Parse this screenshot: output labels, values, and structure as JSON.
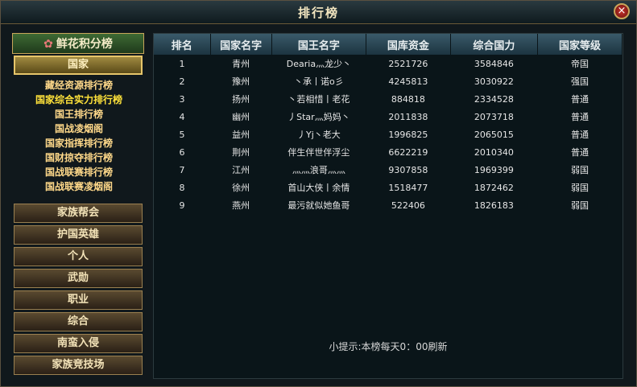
{
  "window": {
    "title": "排行榜",
    "close_label": "×"
  },
  "sidebar": {
    "header": "鲜花积分榜",
    "active_category": "国家",
    "sub_items": [
      {
        "label": "藏经资源排行榜"
      },
      {
        "label": "国家综合实力排行榜"
      },
      {
        "label": "国王排行榜"
      },
      {
        "label": "国战凌烟阁"
      },
      {
        "label": "国家指挥排行榜"
      },
      {
        "label": "国财掠夺排行榜"
      },
      {
        "label": "国战联赛排行榜"
      },
      {
        "label": "国战联赛凌烟阁"
      }
    ],
    "categories": [
      {
        "label": "家族帮会"
      },
      {
        "label": "护国英雄"
      },
      {
        "label": "个人"
      },
      {
        "label": "武勋"
      },
      {
        "label": "职业"
      },
      {
        "label": "综合"
      },
      {
        "label": "南蛮入侵"
      },
      {
        "label": "家族竞技场"
      }
    ]
  },
  "table": {
    "headers": [
      "排名",
      "国家名字",
      "国王名字",
      "国库资金",
      "综合国力",
      "国家等级"
    ],
    "rows": [
      [
        "1",
        "青州",
        "Dearia灬龙少丶",
        "2521726",
        "3584846",
        "帝国"
      ],
      [
        "2",
        "豫州",
        "丶承丨诺o彡",
        "4245813",
        "3030922",
        "强国"
      ],
      [
        "3",
        "扬州",
        "丶若相惜丨老花",
        "884818",
        "2334528",
        "普通"
      ],
      [
        "4",
        "幽州",
        "丿Star灬妈妈丶",
        "2011838",
        "2073718",
        "普通"
      ],
      [
        "5",
        "益州",
        "丿Yj丶老大",
        "1996825",
        "2065015",
        "普通"
      ],
      [
        "6",
        "荆州",
        "伴生伴世伴浮尘",
        "6622219",
        "2010340",
        "普通"
      ],
      [
        "7",
        "江州",
        "灬灬浪哥灬灬",
        "9307858",
        "1969399",
        "弱国"
      ],
      [
        "8",
        "徐州",
        "首山大侠丨余情",
        "1518477",
        "1872462",
        "弱国"
      ],
      [
        "9",
        "燕州",
        "最污就似她鱼哥",
        "522406",
        "1826183",
        "弱国"
      ]
    ]
  },
  "tip": "小提示:本榜每天0：00刷新"
}
